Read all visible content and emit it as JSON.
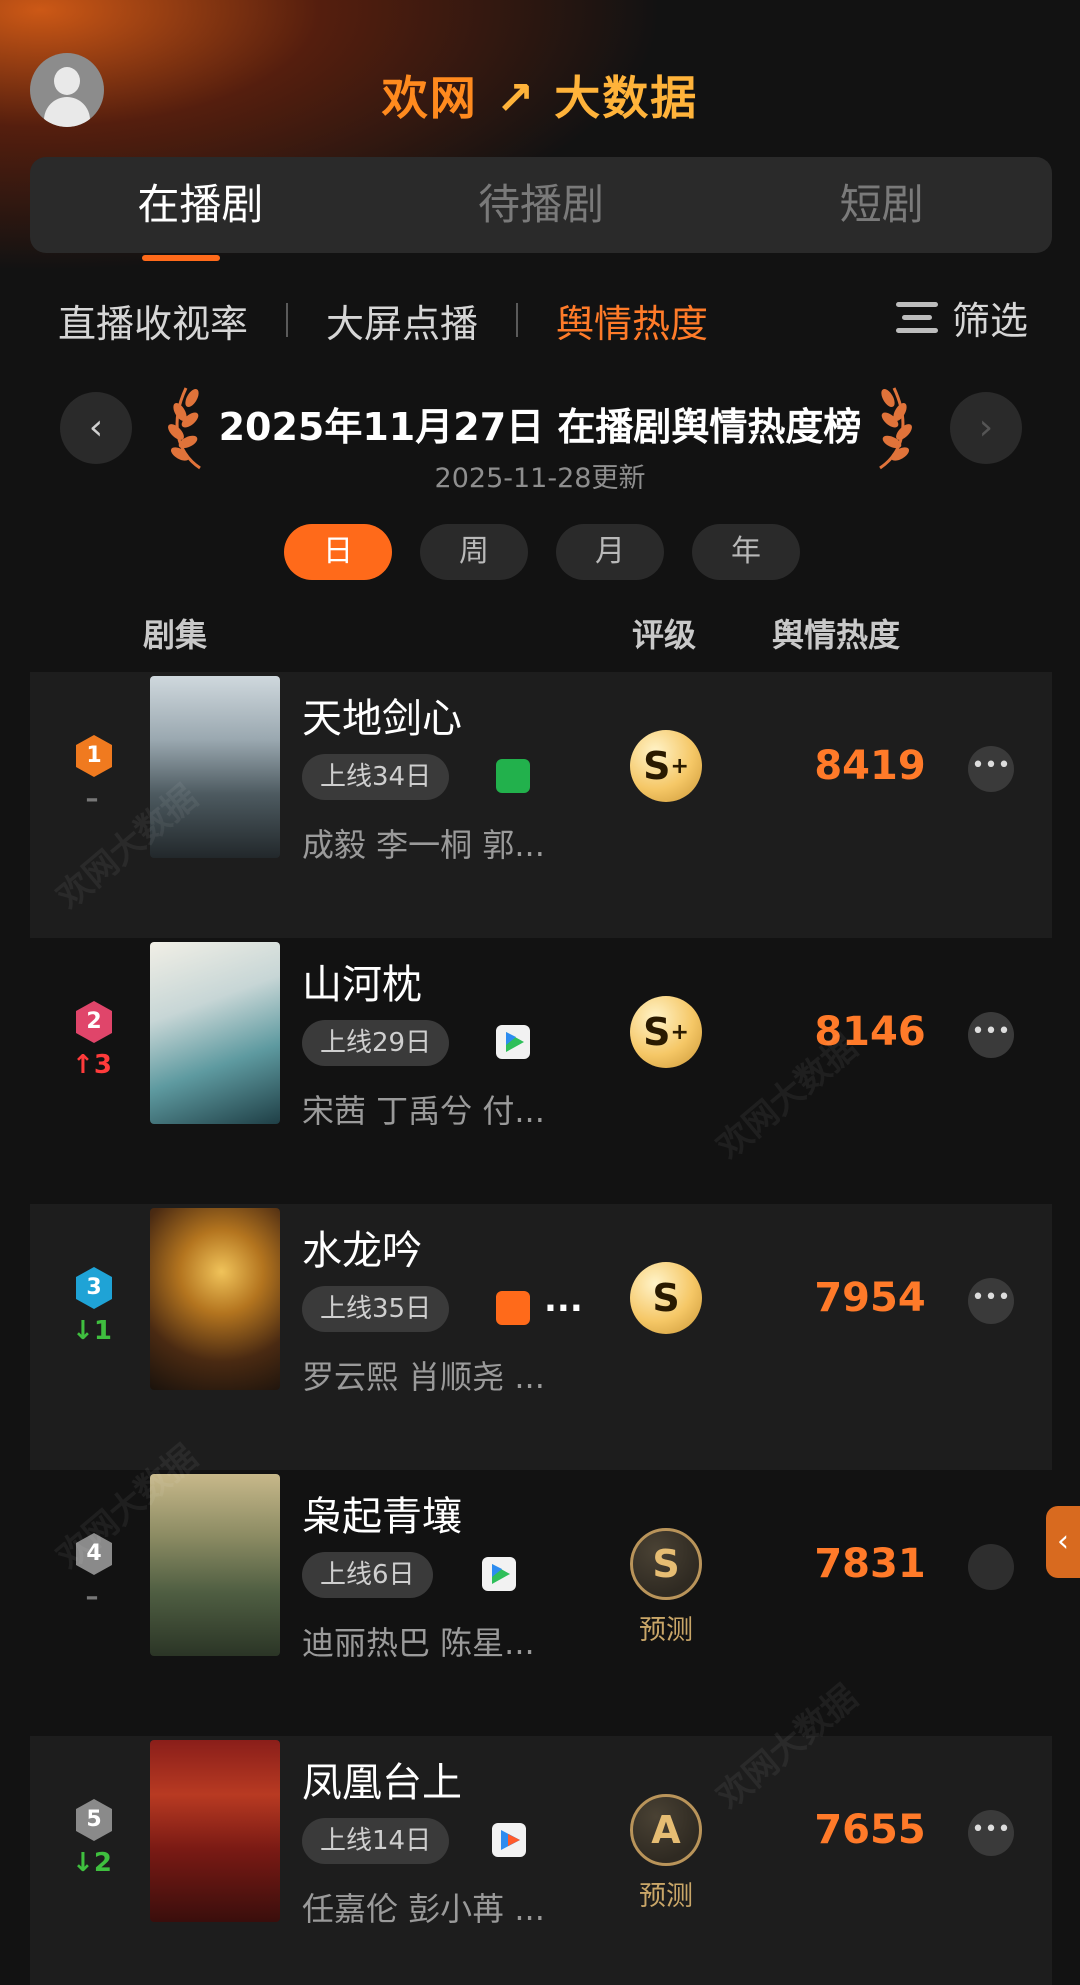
{
  "header": {
    "brand_left": "欢网",
    "brand_right": "大数据"
  },
  "tabs": [
    {
      "label": "在播剧",
      "active": true
    },
    {
      "label": "待播剧",
      "active": false
    },
    {
      "label": "短剧",
      "active": false
    }
  ],
  "subtabs": [
    {
      "label": "直播收视率",
      "active": false
    },
    {
      "label": "大屏点播",
      "active": false
    },
    {
      "label": "舆情热度",
      "active": true
    }
  ],
  "filter_label": "筛选",
  "date_title": "2025年11月27日 在播剧舆情热度榜",
  "date_updated": "2025-11-28更新",
  "periods": [
    {
      "label": "日",
      "active": true
    },
    {
      "label": "周",
      "active": false
    },
    {
      "label": "月",
      "active": false
    },
    {
      "label": "年",
      "active": false
    }
  ],
  "columns": {
    "series": "剧集",
    "grade": "评级",
    "heat": "舆情热度"
  },
  "rows": [
    {
      "rank": "1",
      "change": "–",
      "change_dir": "flat",
      "badge_color": "#f07a1f",
      "title": "天地剑心",
      "days": "上线34日",
      "platform": "iqiyi-icon",
      "platform_color": "#22b14c",
      "cast": "成毅 李一桐 郭...",
      "grade": "S",
      "grade_plus": "+",
      "grade_style": "gold",
      "predict": "",
      "heat": "8419",
      "has_more": true
    },
    {
      "rank": "2",
      "change": "↑3",
      "change_dir": "up",
      "badge_color": "#e0456a",
      "title": "山河枕",
      "days": "上线29日",
      "platform": "tencent-video-icon",
      "platform_color": "#f2f2f2",
      "cast": "宋茜 丁禹兮 付...",
      "grade": "S",
      "grade_plus": "+",
      "grade_style": "gold",
      "predict": "",
      "heat": "8146",
      "has_more": true
    },
    {
      "rank": "3",
      "change": "↓1",
      "change_dir": "down",
      "badge_color": "#1fa3d6",
      "title": "水龙吟",
      "days": "上线35日",
      "platform": "mgtv-icon",
      "platform_color": "#ff6a1a",
      "extra": "...",
      "cast": "罗云熙 肖顺尧 ...",
      "grade": "S",
      "grade_plus": "",
      "grade_style": "gold",
      "predict": "",
      "heat": "7954",
      "has_more": true
    },
    {
      "rank": "4",
      "change": "–",
      "change_dir": "flat",
      "badge_color": "#8a8a8a",
      "title": "枭起青壤",
      "days": "上线6日",
      "platform": "tencent-video-icon",
      "platform_color": "#f2f2f2",
      "cast": "迪丽热巴 陈星...",
      "grade": "S",
      "grade_plus": "",
      "grade_style": "dark",
      "predict": "预测",
      "heat": "7831",
      "has_more": false
    },
    {
      "rank": "5",
      "change": "↓2",
      "change_dir": "down",
      "badge_color": "#8a8a8a",
      "title": "凤凰台上",
      "days": "上线14日",
      "platform": "youku-icon",
      "platform_color": "#f2f2f2",
      "cast": "任嘉伦 彭小苒 ...",
      "grade": "A",
      "grade_plus": "",
      "grade_style": "dark",
      "predict": "预测",
      "heat": "7655",
      "has_more": true
    }
  ],
  "watermark": "欢网大数据"
}
